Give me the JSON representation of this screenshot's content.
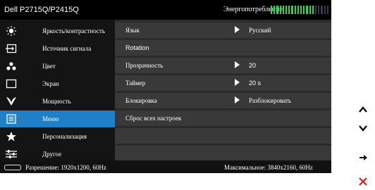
{
  "header": {
    "model": "Dell P2715Q/P2415Q",
    "energy_label": "Энергопотребление",
    "energy_meter": {
      "segments_total": 20,
      "segments_on": 15,
      "on_color": "#27d75a",
      "off_color": "#2f3d52"
    }
  },
  "sidebar": {
    "items": [
      {
        "label": "Яркость/контрастность",
        "icon": "brightness-icon"
      },
      {
        "label": "Источник сигнала",
        "icon": "input-source-icon"
      },
      {
        "label": "Цвет",
        "icon": "color-dots-icon"
      },
      {
        "label": "Экран",
        "icon": "display-icon"
      },
      {
        "label": "Мощность",
        "icon": "power-leaf-icon"
      },
      {
        "label": "Меню",
        "icon": "menu-icon",
        "active": true
      },
      {
        "label": "Персонализация",
        "icon": "star-icon"
      },
      {
        "label": "Другое",
        "icon": "sliders-icon"
      }
    ]
  },
  "menu": {
    "rows": [
      {
        "name": "Язык",
        "value": "Русский"
      },
      {
        "name": "Rotation",
        "value": ""
      },
      {
        "name": "Прозрачность",
        "value": "20"
      },
      {
        "name": "Таймер",
        "value": "20 s"
      },
      {
        "name": "Блокировка",
        "value": "Разблокировать"
      },
      {
        "name": "Сброс всех настроек",
        "value": ""
      }
    ]
  },
  "footer": {
    "resolution": "Разрешение: 1920x1200, 60Hz",
    "max_resolution": "Максимальное: 3840x2160, 60Hz"
  },
  "nav_buttons": [
    "up-arrow-icon",
    "down-arrow-icon",
    "right-arrow-icon",
    "close-x-icon"
  ],
  "colors": {
    "accent": "#1f80c8",
    "close": "#e02020"
  }
}
